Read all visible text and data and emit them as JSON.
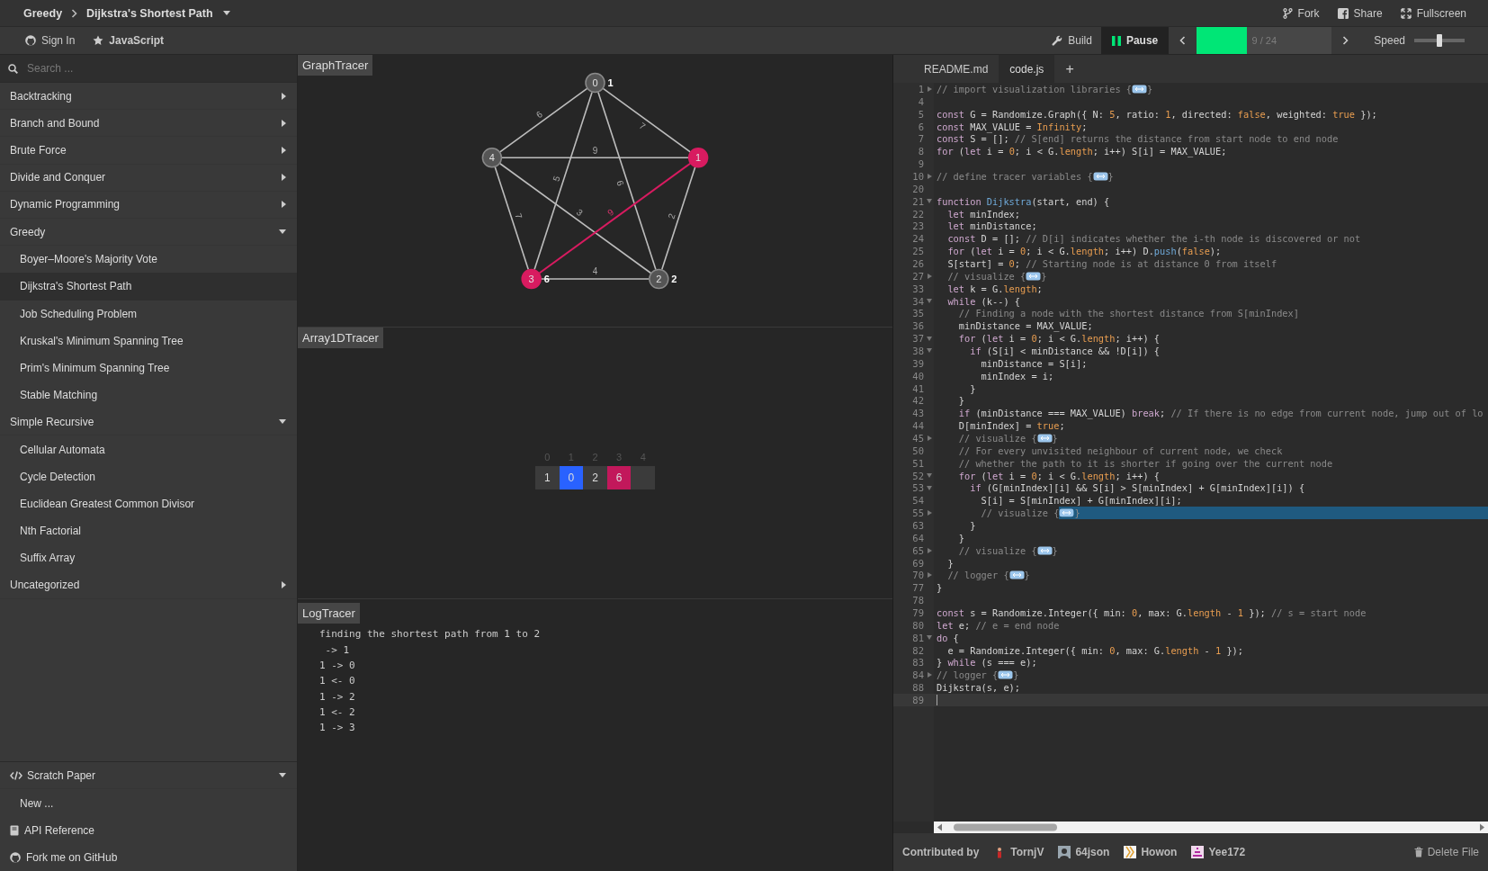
{
  "breadcrumb": {
    "category": "Greedy",
    "algorithm": "Dijkstra's Shortest Path"
  },
  "header_actions": [
    {
      "label": "Fork",
      "kind": "fork"
    },
    {
      "label": "Share",
      "kind": "share"
    },
    {
      "label": "Fullscreen",
      "kind": "fullscreen"
    }
  ],
  "toolbar": {
    "sign_in": "Sign In",
    "language": "JavaScript",
    "build": "Build",
    "player": {
      "label": "Pause",
      "playing": true
    },
    "progress": {
      "text": "9 / 24",
      "level": 0.37
    },
    "speed": {
      "label": "Speed",
      "level": 0.5
    }
  },
  "sidebar": {
    "search": {
      "placeholder": "Search ..."
    },
    "categories": [
      {
        "label": "Backtracking",
        "expanded": false
      },
      {
        "label": "Branch and Bound",
        "expanded": false
      },
      {
        "label": "Brute Force",
        "expanded": false
      },
      {
        "label": "Divide and Conquer",
        "expanded": false
      },
      {
        "label": "Dynamic Programming",
        "expanded": false
      },
      {
        "label": "Greedy",
        "expanded": true,
        "children": [
          {
            "label": "Boyer–Moore's Majority Vote",
            "selected": false
          },
          {
            "label": "Dijkstra's Shortest Path",
            "selected": true
          },
          {
            "label": "Job Scheduling Problem",
            "selected": false
          },
          {
            "label": "Kruskal's Minimum Spanning Tree",
            "selected": false
          },
          {
            "label": "Prim's Minimum Spanning Tree",
            "selected": false
          },
          {
            "label": "Stable Matching",
            "selected": false
          }
        ]
      },
      {
        "label": "Simple Recursive",
        "expanded": true,
        "children": [
          {
            "label": "Cellular Automata",
            "selected": false
          },
          {
            "label": "Cycle Detection",
            "selected": false
          },
          {
            "label": "Euclidean Greatest Common Divisor",
            "selected": false
          },
          {
            "label": "Nth Factorial",
            "selected": false
          },
          {
            "label": "Suffix Array",
            "selected": false
          }
        ]
      },
      {
        "label": "Uncategorized",
        "expanded": false
      }
    ],
    "scratch_paper": {
      "label": "Scratch Paper",
      "expanded": true,
      "items": [
        "New ..."
      ]
    },
    "links": [
      {
        "label": "API Reference",
        "kind": "book"
      },
      {
        "label": "Fork me on GitHub",
        "kind": "github"
      }
    ]
  },
  "graph_tracer": {
    "title": "GraphTracer",
    "nodes": [
      {
        "label": "0",
        "distance": "1",
        "selected": false
      },
      {
        "label": "1",
        "selected": true
      },
      {
        "label": "2",
        "distance": "2",
        "selected": false
      },
      {
        "label": "3",
        "distance": "6",
        "selected": true
      },
      {
        "label": "4",
        "selected": false
      }
    ],
    "edges": [
      {
        "weight": "7",
        "selected": false
      },
      {
        "weight": "6",
        "selected": false
      },
      {
        "weight": "5",
        "selected": false
      },
      {
        "weight": "6",
        "selected": false
      },
      {
        "weight": "2",
        "selected": false
      },
      {
        "weight": "9",
        "selected": true
      },
      {
        "weight": "9",
        "selected": false
      },
      {
        "weight": "4",
        "selected": false
      },
      {
        "weight": "3",
        "selected": false
      },
      {
        "weight": "7",
        "selected": false
      }
    ]
  },
  "array_tracer": {
    "title": "Array1DTracer",
    "cells": [
      {
        "index": "0",
        "value": "1",
        "selected": false,
        "patched": false
      },
      {
        "index": "1",
        "value": "0",
        "selected": true,
        "patched": false
      },
      {
        "index": "2",
        "value": "2",
        "selected": false,
        "patched": false
      },
      {
        "index": "3",
        "value": "6",
        "selected": false,
        "patched": true
      },
      {
        "index": "4",
        "selected": false,
        "patched": false
      }
    ]
  },
  "log_tracer": {
    "title": "LogTracer",
    "lines": [
      "finding the shortest path from 1 to 2",
      " -> 1",
      "1 -> 0",
      "1 <- 0",
      "1 -> 2",
      "1 <- 2",
      "1 -> 3"
    ]
  },
  "editor": {
    "tabs": [
      {
        "label": "README.md",
        "selected": false
      },
      {
        "label": "code.js",
        "selected": true
      }
    ],
    "add_tab": "+",
    "lines": [
      {
        "number": "1",
        "kind": "collapsed",
        "parts": [
          {
            "text": "// import visualization libraries {",
            "kind": "comment"
          }
        ],
        "after": "}",
        "highlighted": false,
        "cursor": false
      },
      {
        "number": "4",
        "kind": "plain",
        "highlighted": false,
        "cursor": false
      },
      {
        "number": "5",
        "kind": "plain",
        "parts": [
          {
            "text": "const",
            "kind": "keyword"
          },
          {
            "text": " G = Randomize.Graph({ N: ",
            "kind": "plain"
          },
          {
            "text": "5",
            "kind": "number"
          },
          {
            "text": ", ratio: ",
            "kind": "plain"
          },
          {
            "text": "1",
            "kind": "number"
          },
          {
            "text": ", directed: ",
            "kind": "plain"
          },
          {
            "text": "false",
            "kind": "number"
          },
          {
            "text": ", weighted: ",
            "kind": "plain"
          },
          {
            "text": "true",
            "kind": "number"
          },
          {
            "text": " });",
            "kind": "plain"
          }
        ],
        "highlighted": false,
        "cursor": false
      },
      {
        "number": "6",
        "kind": "plain",
        "parts": [
          {
            "text": "const",
            "kind": "keyword"
          },
          {
            "text": " MAX_VALUE = ",
            "kind": "plain"
          },
          {
            "text": "Infinity",
            "kind": "number"
          },
          {
            "text": ";",
            "kind": "plain"
          }
        ],
        "highlighted": false,
        "cursor": false
      },
      {
        "number": "7",
        "kind": "plain",
        "parts": [
          {
            "text": "const",
            "kind": "keyword"
          },
          {
            "text": " S = []; ",
            "kind": "plain"
          },
          {
            "text": "// S[end] returns the distance from start node to end node",
            "kind": "comment"
          }
        ],
        "highlighted": false,
        "cursor": false
      },
      {
        "number": "8",
        "kind": "plain",
        "parts": [
          {
            "text": "for",
            "kind": "keyword"
          },
          {
            "text": " (",
            "kind": "plain"
          },
          {
            "text": "let",
            "kind": "keyword"
          },
          {
            "text": " i = ",
            "kind": "plain"
          },
          {
            "text": "0",
            "kind": "number"
          },
          {
            "text": "; i < G.",
            "kind": "plain"
          },
          {
            "text": "length",
            "kind": "number"
          },
          {
            "text": "; i++) S[i] = MAX_VALUE;",
            "kind": "plain"
          }
        ],
        "highlighted": false,
        "cursor": false
      },
      {
        "number": "9",
        "kind": "plain",
        "highlighted": false,
        "cursor": false
      },
      {
        "number": "10",
        "kind": "collapsed",
        "parts": [
          {
            "text": "// define tracer variables {",
            "kind": "comment"
          }
        ],
        "after": "}",
        "highlighted": false,
        "cursor": false
      },
      {
        "number": "20",
        "kind": "plain",
        "highlighted": false,
        "cursor": false
      },
      {
        "number": "21",
        "kind": "expanded",
        "parts": [
          {
            "text": "function",
            "kind": "keyword"
          },
          {
            "text": " Dijkstra",
            "kind": "function"
          },
          {
            "text": "(start, end) {",
            "kind": "plain"
          }
        ],
        "highlighted": false,
        "cursor": false
      },
      {
        "number": "22",
        "kind": "plain",
        "parts": [
          {
            "text": "  let",
            "kind": "keyword"
          },
          {
            "text": " minIndex;",
            "kind": "plain"
          }
        ],
        "highlighted": false,
        "cursor": false
      },
      {
        "number": "23",
        "kind": "plain",
        "parts": [
          {
            "text": "  let",
            "kind": "keyword"
          },
          {
            "text": " minDistance;",
            "kind": "plain"
          }
        ],
        "highlighted": false,
        "cursor": false
      },
      {
        "number": "24",
        "kind": "plain",
        "parts": [
          {
            "text": "  const",
            "kind": "keyword"
          },
          {
            "text": " D = []; ",
            "kind": "plain"
          },
          {
            "text": "// D[i] indicates whether the i-th node is discovered or not",
            "kind": "comment"
          }
        ],
        "highlighted": false,
        "cursor": false
      },
      {
        "number": "25",
        "kind": "plain",
        "parts": [
          {
            "text": "  for",
            "kind": "keyword"
          },
          {
            "text": " (",
            "kind": "plain"
          },
          {
            "text": "let",
            "kind": "keyword"
          },
          {
            "text": " i = ",
            "kind": "plain"
          },
          {
            "text": "0",
            "kind": "number"
          },
          {
            "text": "; i < G.",
            "kind": "plain"
          },
          {
            "text": "length",
            "kind": "number"
          },
          {
            "text": "; i++) D.",
            "kind": "plain"
          },
          {
            "text": "push",
            "kind": "function"
          },
          {
            "text": "(",
            "kind": "plain"
          },
          {
            "text": "false",
            "kind": "number"
          },
          {
            "text": ");",
            "kind": "plain"
          }
        ],
        "highlighted": false,
        "cursor": false
      },
      {
        "number": "26",
        "kind": "plain",
        "parts": [
          {
            "text": "  S[start] = ",
            "kind": "plain"
          },
          {
            "text": "0",
            "kind": "number"
          },
          {
            "text": "; ",
            "kind": "plain"
          },
          {
            "text": "// Starting node is at distance 0 from itself",
            "kind": "comment"
          }
        ],
        "highlighted": false,
        "cursor": false
      },
      {
        "number": "27",
        "kind": "collapsed",
        "parts": [
          {
            "text": "  // visualize {",
            "kind": "comment"
          }
        ],
        "after": "}",
        "highlighted": false,
        "cursor": false
      },
      {
        "number": "33",
        "kind": "plain",
        "parts": [
          {
            "text": "  let",
            "kind": "keyword"
          },
          {
            "text": " k = G.",
            "kind": "plain"
          },
          {
            "text": "length",
            "kind": "number"
          },
          {
            "text": ";",
            "kind": "plain"
          }
        ],
        "highlighted": false,
        "cursor": false
      },
      {
        "number": "34",
        "kind": "expanded",
        "parts": [
          {
            "text": "  while",
            "kind": "keyword"
          },
          {
            "text": " (k--) {",
            "kind": "plain"
          }
        ],
        "highlighted": false,
        "cursor": false
      },
      {
        "number": "35",
        "kind": "plain",
        "parts": [
          {
            "text": "    // Finding a node with the shortest distance from S[minIndex]",
            "kind": "comment"
          }
        ],
        "highlighted": false,
        "cursor": false
      },
      {
        "number": "36",
        "kind": "plain",
        "parts": [
          {
            "text": "    minDistance = MAX_VALUE;",
            "kind": "plain"
          }
        ],
        "highlighted": false,
        "cursor": false
      },
      {
        "number": "37",
        "kind": "expanded",
        "parts": [
          {
            "text": "    for",
            "kind": "keyword"
          },
          {
            "text": " (",
            "kind": "plain"
          },
          {
            "text": "let",
            "kind": "keyword"
          },
          {
            "text": " i = ",
            "kind": "plain"
          },
          {
            "text": "0",
            "kind": "number"
          },
          {
            "text": "; i < G.",
            "kind": "plain"
          },
          {
            "text": "length",
            "kind": "number"
          },
          {
            "text": "; i++) {",
            "kind": "plain"
          }
        ],
        "highlighted": false,
        "cursor": false
      },
      {
        "number": "38",
        "kind": "expanded",
        "parts": [
          {
            "text": "      if",
            "kind": "keyword"
          },
          {
            "text": " (S[i] < minDistance && !D[i]) {",
            "kind": "plain"
          }
        ],
        "highlighted": false,
        "cursor": false
      },
      {
        "number": "39",
        "kind": "plain",
        "parts": [
          {
            "text": "        minDistance = S[i];",
            "kind": "plain"
          }
        ],
        "highlighted": false,
        "cursor": false
      },
      {
        "number": "40",
        "kind": "plain",
        "parts": [
          {
            "text": "        minIndex = i;",
            "kind": "plain"
          }
        ],
        "highlighted": false,
        "cursor": false
      },
      {
        "number": "41",
        "kind": "plain",
        "parts": [
          {
            "text": "      }",
            "kind": "plain"
          }
        ],
        "highlighted": false,
        "cursor": false
      },
      {
        "number": "42",
        "kind": "plain",
        "parts": [
          {
            "text": "    }",
            "kind": "plain"
          }
        ],
        "highlighted": false,
        "cursor": false
      },
      {
        "number": "43",
        "kind": "plain",
        "parts": [
          {
            "text": "    if",
            "kind": "keyword"
          },
          {
            "text": " (minDistance === MAX_VALUE) ",
            "kind": "plain"
          },
          {
            "text": "break",
            "kind": "keyword"
          },
          {
            "text": "; ",
            "kind": "plain"
          },
          {
            "text": "// If there is no edge from current node, jump out of lo",
            "kind": "comment"
          }
        ],
        "highlighted": false,
        "cursor": false
      },
      {
        "number": "44",
        "kind": "plain",
        "parts": [
          {
            "text": "    D[minIndex] = ",
            "kind": "plain"
          },
          {
            "text": "true",
            "kind": "number"
          },
          {
            "text": ";",
            "kind": "plain"
          }
        ],
        "highlighted": false,
        "cursor": false
      },
      {
        "number": "45",
        "kind": "collapsed",
        "parts": [
          {
            "text": "    // visualize {",
            "kind": "comment"
          }
        ],
        "after": "}",
        "highlighted": false,
        "cursor": false
      },
      {
        "number": "50",
        "kind": "plain",
        "parts": [
          {
            "text": "    // For every unvisited neighbour of current node, we check",
            "kind": "comment"
          }
        ],
        "highlighted": false,
        "cursor": false
      },
      {
        "number": "51",
        "kind": "plain",
        "parts": [
          {
            "text": "    // whether the path to it is shorter if going over the current node",
            "kind": "comment"
          }
        ],
        "highlighted": false,
        "cursor": false
      },
      {
        "number": "52",
        "kind": "expanded",
        "parts": [
          {
            "text": "    for",
            "kind": "keyword"
          },
          {
            "text": " (",
            "kind": "plain"
          },
          {
            "text": "let",
            "kind": "keyword"
          },
          {
            "text": " i = ",
            "kind": "plain"
          },
          {
            "text": "0",
            "kind": "number"
          },
          {
            "text": "; i < G.",
            "kind": "plain"
          },
          {
            "text": "length",
            "kind": "number"
          },
          {
            "text": "; i++) {",
            "kind": "plain"
          }
        ],
        "highlighted": false,
        "cursor": false
      },
      {
        "number": "53",
        "kind": "expanded",
        "parts": [
          {
            "text": "      if",
            "kind": "keyword"
          },
          {
            "text": " (G[minIndex][i] && S[i] > S[minIndex] + G[minIndex][i]) {",
            "kind": "plain"
          }
        ],
        "highlighted": false,
        "cursor": false
      },
      {
        "number": "54",
        "kind": "plain",
        "parts": [
          {
            "text": "        S[i] = S[minIndex] + G[minIndex][i];",
            "kind": "plain"
          }
        ],
        "highlighted": false,
        "cursor": false
      },
      {
        "number": "55",
        "kind": "collapsed",
        "parts": [
          {
            "text": "        // visualize {",
            "kind": "comment"
          }
        ],
        "after": "}",
        "highlighted": true,
        "cursor": false
      },
      {
        "number": "63",
        "kind": "plain",
        "parts": [
          {
            "text": "      }",
            "kind": "plain"
          }
        ],
        "highlighted": false,
        "cursor": false
      },
      {
        "number": "64",
        "kind": "plain",
        "parts": [
          {
            "text": "    }",
            "kind": "plain"
          }
        ],
        "highlighted": false,
        "cursor": false
      },
      {
        "number": "65",
        "kind": "collapsed",
        "parts": [
          {
            "text": "    // visualize {",
            "kind": "comment"
          }
        ],
        "after": "}",
        "highlighted": false,
        "cursor": false
      },
      {
        "number": "69",
        "kind": "plain",
        "parts": [
          {
            "text": "  }",
            "kind": "plain"
          }
        ],
        "highlighted": false,
        "cursor": false
      },
      {
        "number": "70",
        "kind": "collapsed",
        "parts": [
          {
            "text": "  // logger {",
            "kind": "comment"
          }
        ],
        "after": "}",
        "highlighted": false,
        "cursor": false
      },
      {
        "number": "77",
        "kind": "plain",
        "parts": [
          {
            "text": "}",
            "kind": "plain"
          }
        ],
        "highlighted": false,
        "cursor": false
      },
      {
        "number": "78",
        "kind": "plain",
        "highlighted": false,
        "cursor": false
      },
      {
        "number": "79",
        "kind": "plain",
        "parts": [
          {
            "text": "const",
            "kind": "keyword"
          },
          {
            "text": " s = Randomize.Integer({ min: ",
            "kind": "plain"
          },
          {
            "text": "0",
            "kind": "number"
          },
          {
            "text": ", max: G.",
            "kind": "plain"
          },
          {
            "text": "length",
            "kind": "number"
          },
          {
            "text": " - ",
            "kind": "plain"
          },
          {
            "text": "1",
            "kind": "number"
          },
          {
            "text": " }); ",
            "kind": "plain"
          },
          {
            "text": "// s = start node",
            "kind": "comment"
          }
        ],
        "highlighted": false,
        "cursor": false
      },
      {
        "number": "80",
        "kind": "plain",
        "parts": [
          {
            "text": "let",
            "kind": "keyword"
          },
          {
            "text": " e; ",
            "kind": "plain"
          },
          {
            "text": "// e = end node",
            "kind": "comment"
          }
        ],
        "highlighted": false,
        "cursor": false
      },
      {
        "number": "81",
        "kind": "expanded",
        "parts": [
          {
            "text": "do",
            "kind": "keyword"
          },
          {
            "text": " {",
            "kind": "plain"
          }
        ],
        "highlighted": false,
        "cursor": false
      },
      {
        "number": "82",
        "kind": "plain",
        "parts": [
          {
            "text": "  e = Randomize.Integer({ min: ",
            "kind": "plain"
          },
          {
            "text": "0",
            "kind": "number"
          },
          {
            "text": ", max: G.",
            "kind": "plain"
          },
          {
            "text": "length",
            "kind": "number"
          },
          {
            "text": " - ",
            "kind": "plain"
          },
          {
            "text": "1",
            "kind": "number"
          },
          {
            "text": " });",
            "kind": "plain"
          }
        ],
        "highlighted": false,
        "cursor": false
      },
      {
        "number": "83",
        "kind": "plain",
        "parts": [
          {
            "text": "} ",
            "kind": "plain"
          },
          {
            "text": "while",
            "kind": "keyword"
          },
          {
            "text": " (s === e);",
            "kind": "plain"
          }
        ],
        "highlighted": false,
        "cursor": false
      },
      {
        "number": "84",
        "kind": "collapsed",
        "parts": [
          {
            "text": "// logger {",
            "kind": "comment"
          }
        ],
        "after": "}",
        "highlighted": false,
        "cursor": false
      },
      {
        "number": "88",
        "kind": "plain",
        "parts": [
          {
            "text": "Dijkstra(s, e);",
            "kind": "plain"
          }
        ],
        "highlighted": false,
        "cursor": false
      },
      {
        "number": "89",
        "kind": "plain",
        "highlighted": false,
        "cursor": true
      }
    ]
  },
  "footer": {
    "label": "Contributed by",
    "contributors": [
      "TornjV",
      "64json",
      "Howon",
      "Yee172"
    ],
    "delete": "Delete File"
  }
}
